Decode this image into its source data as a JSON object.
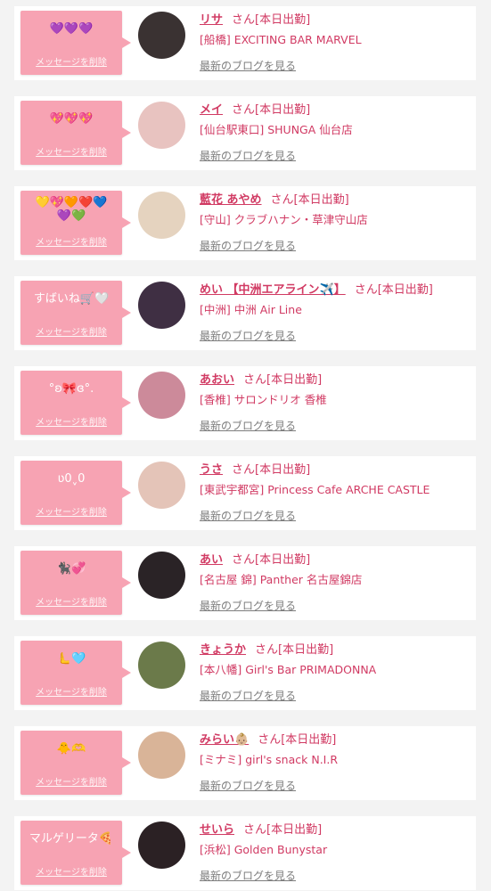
{
  "cards": [
    {
      "message": "💜💜💜",
      "delete_label": "メッセージを削除",
      "name": "リサ",
      "san": "さん",
      "status": "[本日出勤]",
      "shop": "[船橋] EXCITING BAR MARVEL",
      "blog_link": "最新のブログを見る",
      "avatar_color": "#3a3232"
    },
    {
      "message": "💖💖💖",
      "delete_label": "メッセージを削除",
      "name": "メイ",
      "san": "さん",
      "status": "[本日出勤]",
      "shop": "[仙台駅東口] SHUNGA 仙台店",
      "blog_link": "最新のブログを見る",
      "avatar_color": "#e8c3c0"
    },
    {
      "message": "💛💖🧡❤️💙💜💚",
      "delete_label": "メッセージを削除",
      "name": "藍花 あやめ",
      "san": "さん",
      "status": "[本日出勤]",
      "shop": "[守山] クラブハナン・草津守山店",
      "blog_link": "最新のブログを見る",
      "avatar_color": "#e5d3bf"
    },
    {
      "message": "すばいね🛒🤍",
      "delete_label": "メッセージを削除",
      "name": "めい 【中洲エアライン✈️】",
      "san": "さん",
      "status": "[本日出勤]",
      "shop": "[中洲] 中洲 Air Line",
      "blog_link": "最新のブログを見る",
      "avatar_color": "#3f2f43"
    },
    {
      "message": "°ʚ🎀ɞ°.",
      "delete_label": "メッセージを削除",
      "name": "あおい",
      "san": "さん",
      "status": "[本日出勤]",
      "shop": "[香椎] サロンドリオ 香椎",
      "blog_link": "最新のブログを見る",
      "avatar_color": "#cc8a9a"
    },
    {
      "message": "ʋ0ˬ0",
      "delete_label": "メッセージを削除",
      "name": "うさ",
      "san": "さん",
      "status": "[本日出勤]",
      "shop": "[東武宇都宮] Princess Cafe ARCHE CASTLE",
      "blog_link": "最新のブログを見る",
      "avatar_color": "#e4c4b8"
    },
    {
      "message": "🐈‍⬛💞",
      "delete_label": "メッセージを削除",
      "name": "あい",
      "san": "さん",
      "status": "[本日出勤]",
      "shop": "[名古屋 錦] Panther 名古屋錦店",
      "blog_link": "最新のブログを見る",
      "avatar_color": "#2a2326"
    },
    {
      "message": "🫷🩵",
      "delete_label": "メッセージを削除",
      "name": "きょうか",
      "san": "さん",
      "status": "[本日出勤]",
      "shop": "[本八幡] Girl's Bar PRIMADONNA",
      "blog_link": "最新のブログを見る",
      "avatar_color": "#6b7a4a"
    },
    {
      "message": "🐥🫶",
      "delete_label": "メッセージを削除",
      "name": "みらい👶🏼",
      "san": "さん",
      "status": "[本日出勤]",
      "shop": "[ミナミ] girl's snack N.I.R",
      "blog_link": "最新のブログを見る",
      "avatar_color": "#d9b498"
    },
    {
      "message": "マルゲリータ🍕",
      "delete_label": "メッセージを削除",
      "name": "せいら",
      "san": "さん",
      "status": "[本日出勤]",
      "shop": "[浜松] Golden Bunystar",
      "blog_link": "最新のブログを見る",
      "avatar_color": "#2b2124"
    }
  ]
}
